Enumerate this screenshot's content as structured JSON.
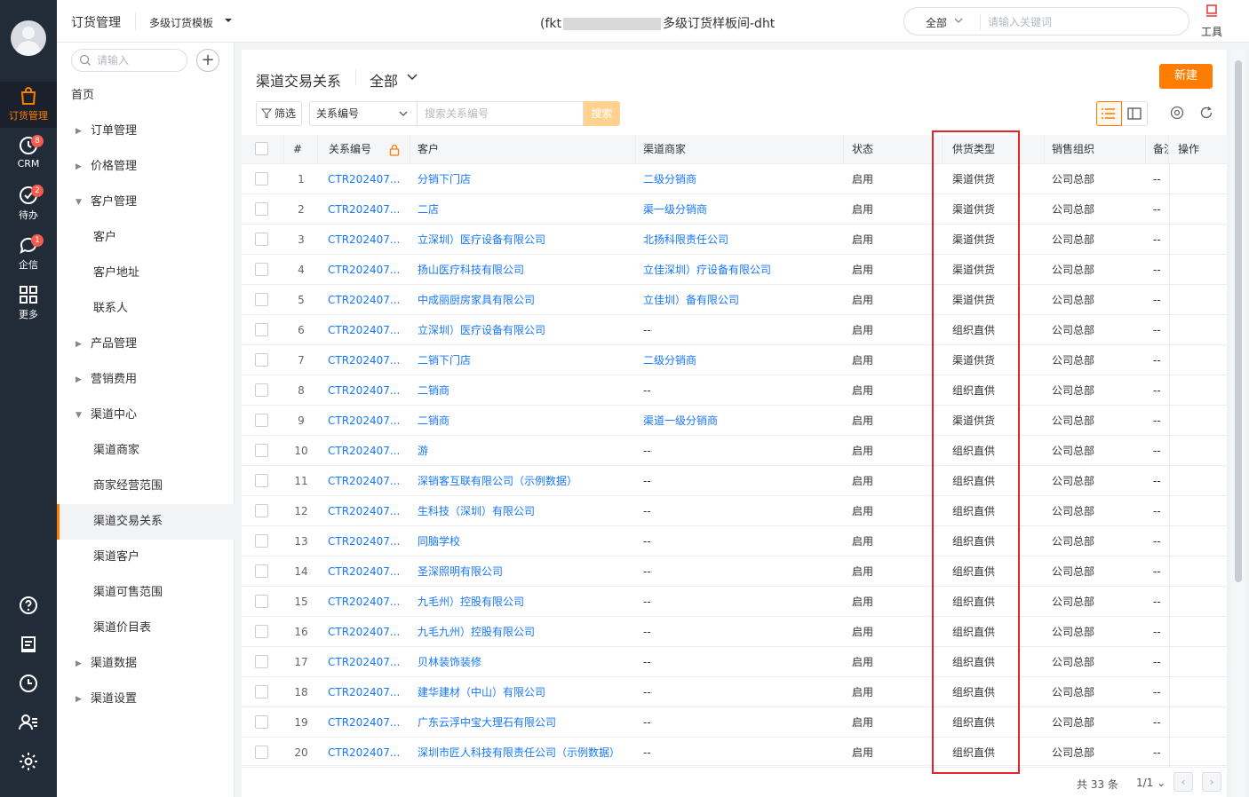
{
  "rail": {
    "items": [
      {
        "label": "订货管理",
        "icon": "bag-icon",
        "badge": null
      },
      {
        "label": "CRM",
        "icon": "crm-icon",
        "badge": "8"
      },
      {
        "label": "待办",
        "icon": "check-icon",
        "badge": "2"
      },
      {
        "label": "企信",
        "icon": "chat-icon",
        "badge": "1"
      },
      {
        "label": "更多",
        "icon": "grid-icon",
        "badge": null
      }
    ]
  },
  "topbar": {
    "module_title": "订货管理",
    "template": "多级订货模板",
    "center_prefix": "(fkt",
    "center_suffix": "多级订货样板间-dht",
    "search_scope": "全部",
    "search_placeholder": "请输入关键词",
    "tools_label": "工具"
  },
  "subnav": {
    "search_placeholder": "请输入",
    "items": [
      {
        "label": "首页",
        "type": "lvl0"
      },
      {
        "label": "订单管理",
        "type": "group",
        "caret": "▶"
      },
      {
        "label": "价格管理",
        "type": "group",
        "caret": "▶"
      },
      {
        "label": "客户管理",
        "type": "group",
        "caret": "▼"
      },
      {
        "label": "客户",
        "type": "child"
      },
      {
        "label": "客户地址",
        "type": "child"
      },
      {
        "label": "联系人",
        "type": "child"
      },
      {
        "label": "产品管理",
        "type": "group",
        "caret": "▶"
      },
      {
        "label": "营销费用",
        "type": "group",
        "caret": "▶"
      },
      {
        "label": "渠道中心",
        "type": "group",
        "caret": "▼"
      },
      {
        "label": "渠道商家",
        "type": "child"
      },
      {
        "label": "商家经营范围",
        "type": "child"
      },
      {
        "label": "渠道交易关系",
        "type": "child",
        "active": true
      },
      {
        "label": "渠道客户",
        "type": "child"
      },
      {
        "label": "渠道可售范围",
        "type": "child"
      },
      {
        "label": "渠道价目表",
        "type": "child"
      },
      {
        "label": "渠道数据",
        "type": "group",
        "caret": "▶"
      },
      {
        "label": "渠道设置",
        "type": "group",
        "caret": "▶"
      }
    ]
  },
  "page": {
    "title": "渠道交易关系",
    "scope_filter": "全部",
    "new_button": "新建",
    "filter_button": "筛选",
    "field_select": "关系编号",
    "search_placeholder": "搜索关系编号",
    "search_button": "搜索"
  },
  "table": {
    "columns": [
      "#",
      "关系编号",
      "客户",
      "渠道商家",
      "状态",
      "供货类型",
      "销售组织",
      "备注",
      "操作"
    ],
    "rows": [
      {
        "idx": "1",
        "code": "CTR202407...",
        "customer": "分销下门店",
        "merchant": "二级分销商",
        "status": "启用",
        "supply": "渠道供货",
        "org": "公司总部",
        "note": "--"
      },
      {
        "idx": "2",
        "code": "CTR202407...",
        "customer": "二店",
        "merchant": "渠一级分销商",
        "status": "启用",
        "supply": "渠道供货",
        "org": "公司总部",
        "note": "--"
      },
      {
        "idx": "3",
        "code": "CTR202407...",
        "customer": "立深圳）医疗设备有限公司",
        "merchant": "北扬科限责任公司",
        "status": "启用",
        "supply": "渠道供货",
        "org": "公司总部",
        "note": "--"
      },
      {
        "idx": "4",
        "code": "CTR202407...",
        "customer": "扬山医疗科技有限公司",
        "merchant": "立佳深圳）疗设备有限公司",
        "status": "启用",
        "supply": "渠道供货",
        "org": "公司总部",
        "note": "--"
      },
      {
        "idx": "5",
        "code": "CTR202407...",
        "customer": "中成丽厨房家具有限公司",
        "merchant": "立佳圳）备有限公司",
        "status": "启用",
        "supply": "渠道供货",
        "org": "公司总部",
        "note": "--"
      },
      {
        "idx": "6",
        "code": "CTR202407...",
        "customer": "立深圳）医疗设备有限公司",
        "merchant": "--",
        "status": "启用",
        "supply": "组织直供",
        "org": "公司总部",
        "note": "--"
      },
      {
        "idx": "7",
        "code": "CTR202407...",
        "customer": "二销下门店",
        "merchant": "二级分销商",
        "status": "启用",
        "supply": "渠道供货",
        "org": "公司总部",
        "note": "--"
      },
      {
        "idx": "8",
        "code": "CTR202407...",
        "customer": "二销商",
        "merchant": "--",
        "status": "启用",
        "supply": "组织直供",
        "org": "公司总部",
        "note": "--"
      },
      {
        "idx": "9",
        "code": "CTR202407...",
        "customer": "二销商",
        "merchant": "渠道一级分销商",
        "status": "启用",
        "supply": "渠道供货",
        "org": "公司总部",
        "note": "--"
      },
      {
        "idx": "10",
        "code": "CTR202407...",
        "customer": "游",
        "merchant": "--",
        "status": "启用",
        "supply": "组织直供",
        "org": "公司总部",
        "note": "--"
      },
      {
        "idx": "11",
        "code": "CTR202407...",
        "customer": "深销客互联有限公司（示例数据）",
        "merchant": "--",
        "status": "启用",
        "supply": "组织直供",
        "org": "公司总部",
        "note": "--"
      },
      {
        "idx": "12",
        "code": "CTR202407...",
        "customer": "生科技（深圳）有限公司",
        "merchant": "--",
        "status": "启用",
        "supply": "组织直供",
        "org": "公司总部",
        "note": "--"
      },
      {
        "idx": "13",
        "code": "CTR202407...",
        "customer": "同脑学校",
        "merchant": "--",
        "status": "启用",
        "supply": "组织直供",
        "org": "公司总部",
        "note": "--"
      },
      {
        "idx": "14",
        "code": "CTR202407...",
        "customer": "圣深照明有限公司",
        "merchant": "--",
        "status": "启用",
        "supply": "组织直供",
        "org": "公司总部",
        "note": "--"
      },
      {
        "idx": "15",
        "code": "CTR202407...",
        "customer": "九毛州）控股有限公司",
        "merchant": "--",
        "status": "启用",
        "supply": "组织直供",
        "org": "公司总部",
        "note": "--"
      },
      {
        "idx": "16",
        "code": "CTR202407...",
        "customer": "九毛九州）控股有限公司",
        "merchant": "--",
        "status": "启用",
        "supply": "组织直供",
        "org": "公司总部",
        "note": "--"
      },
      {
        "idx": "17",
        "code": "CTR202407...",
        "customer": "贝林装饰装修",
        "merchant": "--",
        "status": "启用",
        "supply": "组织直供",
        "org": "公司总部",
        "note": "--"
      },
      {
        "idx": "18",
        "code": "CTR202407...",
        "customer": "建华建材（中山）有限公司",
        "merchant": "--",
        "status": "启用",
        "supply": "组织直供",
        "org": "公司总部",
        "note": "--"
      },
      {
        "idx": "19",
        "code": "CTR202407...",
        "customer": "广东云浮中宝大理石有限公司",
        "merchant": "--",
        "status": "启用",
        "supply": "组织直供",
        "org": "公司总部",
        "note": "--"
      },
      {
        "idx": "20",
        "code": "CTR202407...",
        "customer": "深圳市匠人科技有限责任公司（示例数据）",
        "merchant": "--",
        "status": "启用",
        "supply": "组织直供",
        "org": "公司总部",
        "note": "--"
      }
    ]
  },
  "footer": {
    "total": "共 33 条",
    "page": "1/1"
  },
  "colors": {
    "accent": "#ff7d00",
    "link": "#1677ff",
    "highlight": "#e5242b",
    "rail_bg": "#222b38"
  }
}
